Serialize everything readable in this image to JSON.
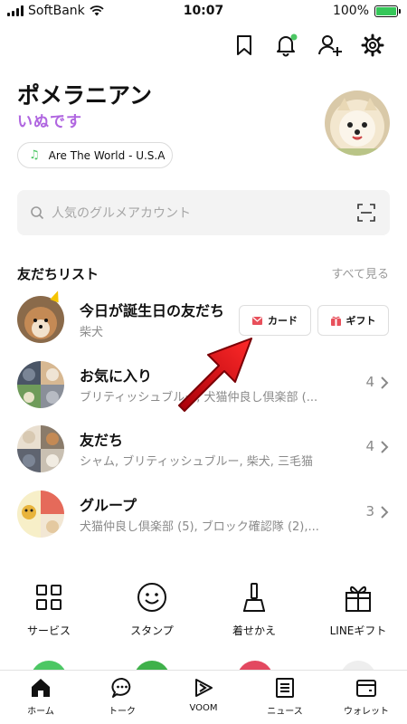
{
  "status_bar": {
    "carrier": "SoftBank",
    "time": "10:07",
    "battery": "100%"
  },
  "header": {
    "icons": [
      "bookmark-icon",
      "bell-icon",
      "add-friend-icon",
      "gear-icon"
    ],
    "notification_dot_color": "#4cc764"
  },
  "profile": {
    "name": "ポメラニアン",
    "status": "いぬです",
    "music": "Are The World - U.S.A"
  },
  "search": {
    "placeholder": "人気のグルメアカウント"
  },
  "friends": {
    "title": "友だちリスト",
    "see_all": "すべて見る",
    "birthday": {
      "title": "今日が誕生日の友だち",
      "subtitle": "柴犬",
      "card_label": "カード",
      "gift_label": "ギフト"
    },
    "rows": [
      {
        "title": "お気に入り",
        "subtitle": "ブリティッシュブルー, 犬猫仲良し倶楽部 (...",
        "count": "4"
      },
      {
        "title": "友だち",
        "subtitle": "シャム, ブリティッシュブルー, 柴犬, 三毛猫",
        "count": "4"
      },
      {
        "title": "グループ",
        "subtitle": "犬猫仲良し倶楽部 (5), ブロック確認隊 (2),...",
        "count": "3"
      }
    ]
  },
  "services": [
    {
      "label": "サービス",
      "icon": "grid-icon"
    },
    {
      "label": "スタンプ",
      "icon": "smiley-icon"
    },
    {
      "label": "着せかえ",
      "icon": "brush-icon"
    },
    {
      "label": "LINEギフト",
      "icon": "gift-icon"
    }
  ],
  "tabs": [
    {
      "label": "ホーム",
      "icon": "home-icon",
      "active": true
    },
    {
      "label": "トーク",
      "icon": "chat-icon"
    },
    {
      "label": "VOOM",
      "icon": "voom-icon"
    },
    {
      "label": "ニュース",
      "icon": "news-icon"
    },
    {
      "label": "ウォレット",
      "icon": "wallet-icon"
    }
  ],
  "colors": {
    "accent_green": "#4cc764",
    "arrow_red": "#e5121b",
    "status_purple": "#b066e0"
  }
}
